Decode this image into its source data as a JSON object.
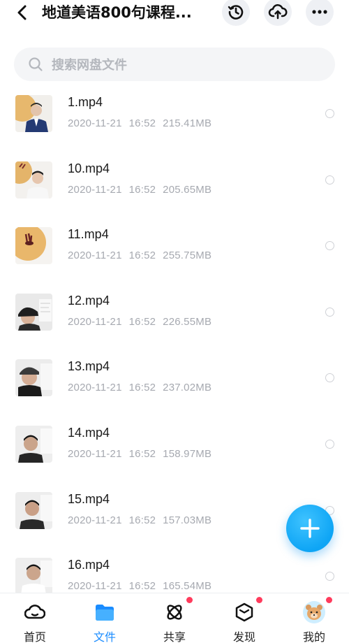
{
  "header": {
    "title": "地道美语800句课程...",
    "back_icon": "chevron-left-icon",
    "actions": [
      "history-icon",
      "cloud-upload-icon",
      "more-icon"
    ]
  },
  "search": {
    "placeholder": "搜索网盘文件"
  },
  "files": [
    {
      "name": "1.mp4",
      "date": "2020-11-21",
      "time": "16:52",
      "size": "215.41MB"
    },
    {
      "name": "10.mp4",
      "date": "2020-11-21",
      "time": "16:52",
      "size": "205.65MB"
    },
    {
      "name": "11.mp4",
      "date": "2020-11-21",
      "time": "16:52",
      "size": "255.75MB"
    },
    {
      "name": "12.mp4",
      "date": "2020-11-21",
      "time": "16:52",
      "size": "226.55MB"
    },
    {
      "name": "13.mp4",
      "date": "2020-11-21",
      "time": "16:52",
      "size": "237.02MB"
    },
    {
      "name": "14.mp4",
      "date": "2020-11-21",
      "time": "16:52",
      "size": "158.97MB"
    },
    {
      "name": "15.mp4",
      "date": "2020-11-21",
      "time": "16:52",
      "size": "157.03MB"
    },
    {
      "name": "16.mp4",
      "date": "2020-11-21",
      "time": "16:52",
      "size": "165.54MB"
    }
  ],
  "fab": {
    "icon": "plus-icon",
    "color": "#0ea5f5"
  },
  "nav": {
    "items": [
      {
        "label": "首页",
        "icon": "cloud-home-icon"
      },
      {
        "label": "文件",
        "icon": "folder-icon"
      },
      {
        "label": "共享",
        "icon": "atom-share-icon"
      },
      {
        "label": "发现",
        "icon": "cube-discover-icon"
      },
      {
        "label": "我的",
        "icon": "avatar-icon"
      }
    ],
    "active": "文件",
    "active_color": "#1a8cff",
    "badge_color": "#ff3b5c"
  }
}
